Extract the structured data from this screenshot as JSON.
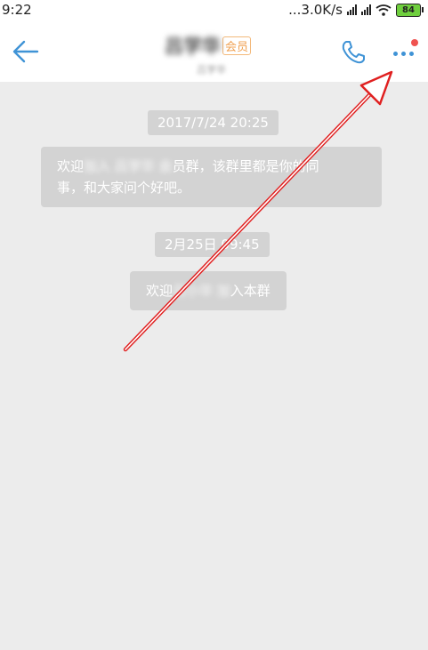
{
  "status_bar": {
    "time": "9:22",
    "net_speed": "...3.0K/s",
    "battery": "84"
  },
  "header": {
    "title": "吕学华",
    "badge": "会员",
    "subtitle": "吕学华"
  },
  "messages": {
    "ts1": "2017/7/24 20:25",
    "msg1": {
      "line1_a": "欢迎",
      "line1_blur": "加入 吕学华 会",
      "line1_b": "员群，该群里都是你的同",
      "line2_a": "事，和大家问个好吧。"
    },
    "ts2": "2月25日 09:45",
    "msg2": {
      "prefix": "欢迎",
      "blur": "吕小华 加",
      "suffix": "入本群"
    }
  },
  "colors": {
    "accent": "#3f93d6",
    "annotation_arrow": "#e02020",
    "notification_dot": "#ef5350"
  }
}
